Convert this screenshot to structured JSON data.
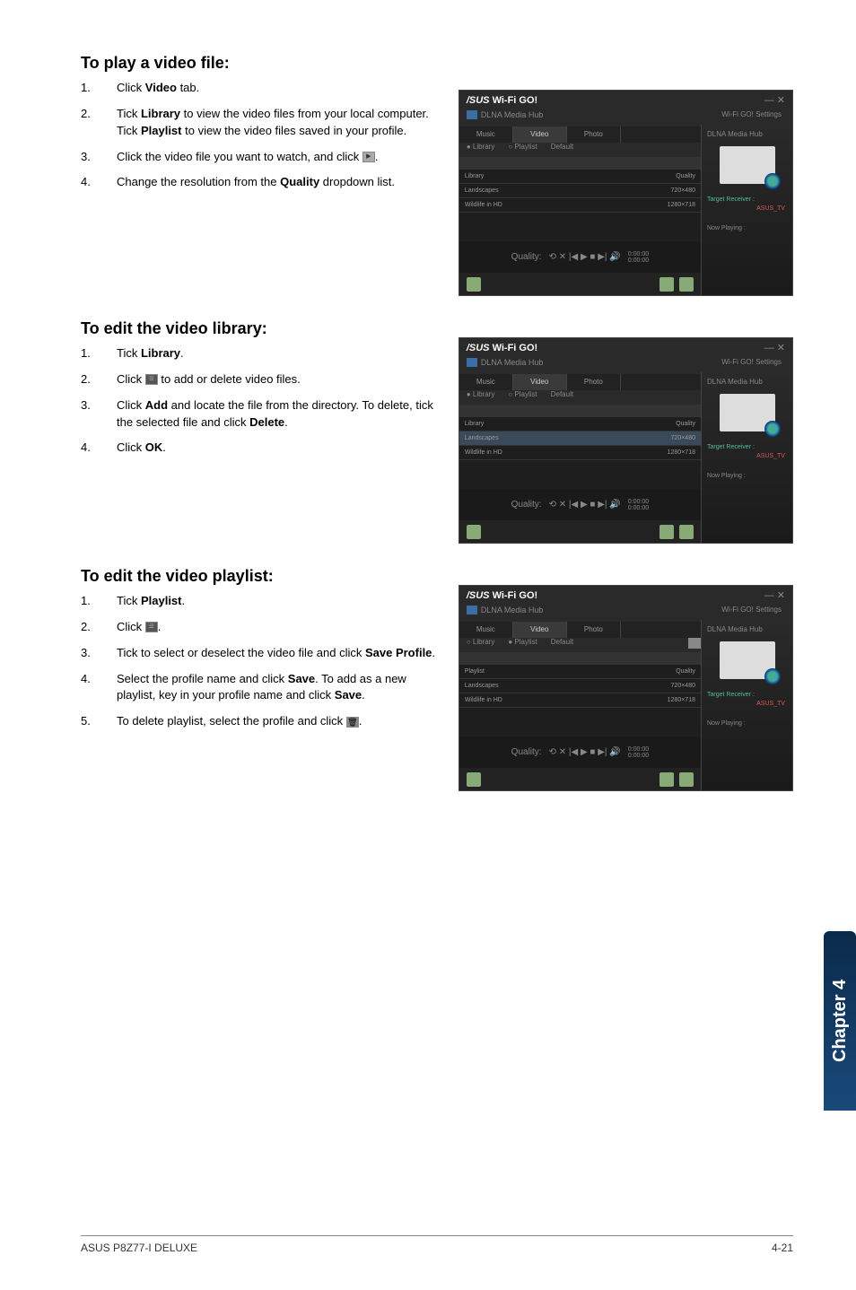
{
  "sections": {
    "play_video": {
      "heading": "To play a video file:",
      "steps": {
        "s1": {
          "n": "1.",
          "pre": "Click ",
          "bold": "Video",
          "post": " tab."
        },
        "s2": {
          "n": "2.",
          "t1": "Tick ",
          "b1": "Library",
          "t2": " to view the video files from your local computer. Tick ",
          "b2": "Playlist",
          "t3": " to view the video files saved in your profile."
        },
        "s3": {
          "n": "3.",
          "t1": "Click the video file you want to watch, and click ",
          "post": "."
        },
        "s4": {
          "n": "4.",
          "t1": "Change the resolution from the ",
          "b1": "Quality",
          "t2": " dropdown list."
        }
      }
    },
    "edit_library": {
      "heading": "To edit the video library:",
      "steps": {
        "s1": {
          "n": "1.",
          "t1": "Tick ",
          "b1": "Library",
          "post": "."
        },
        "s2": {
          "n": "2.",
          "t1": "Click ",
          "t2": " to add or delete video files."
        },
        "s3": {
          "n": "3.",
          "t1": "Click ",
          "b1": "Add",
          "t2": " and locate the file from the directory. To delete, tick the selected file and click ",
          "b2": "Delete",
          "post": "."
        },
        "s4": {
          "n": "4.",
          "t1": "Click ",
          "b1": "OK",
          "post": "."
        }
      }
    },
    "edit_playlist": {
      "heading": "To edit the video playlist:",
      "steps": {
        "s1": {
          "n": "1.",
          "t1": "Tick ",
          "b1": "Playlist",
          "post": "."
        },
        "s2": {
          "n": "2.",
          "t1": "Click ",
          "post": "."
        },
        "s3": {
          "n": "3.",
          "t1": "Tick to select or deselect the video file and click ",
          "b1": "Save Profile",
          "post": "."
        },
        "s4": {
          "n": "4.",
          "t1": "Select the profile name and click ",
          "b1": "Save",
          "t2": ". To add as a new playlist, key in your profile name and click ",
          "b2": "Save",
          "post": "."
        },
        "s5": {
          "n": "5.",
          "t1": "To delete playlist, select the profile and click ",
          "post": "."
        }
      }
    }
  },
  "screenshot": {
    "title_brand": "/SUS",
    "title_text": "Wi-Fi GO!",
    "close": "— ✕",
    "subtitle": "DLNA Media Hub",
    "settings_link": "Wi-Fi GO! Settings",
    "dlna_label": "DLNA Media Hub",
    "tabs": {
      "music": "Music",
      "video": "Video",
      "photo": "Photo"
    },
    "radios": {
      "lib": "Library",
      "playlist": "Playlist",
      "def": "Default"
    },
    "list_rows": {
      "r1": {
        "l": "Library",
        "r": "Quality"
      },
      "r2": {
        "l": "Landscapes",
        "r": "720×480"
      },
      "r3": {
        "l": "Wildlife in HD",
        "r": "1280×718"
      }
    },
    "target": "Target Receiver :",
    "target_val": "ASUS_TV",
    "now": "Now Playing :",
    "time1": "0:00:00",
    "time2": "0:00:00",
    "ctrl_quality": "Quality:",
    "controls": "⟲ ✕ |◀ ▶ ■ ▶| 🔊"
  },
  "sidebar": "Chapter 4",
  "footer": {
    "left": "ASUS P8Z77-I DELUXE",
    "right": "4-21"
  }
}
